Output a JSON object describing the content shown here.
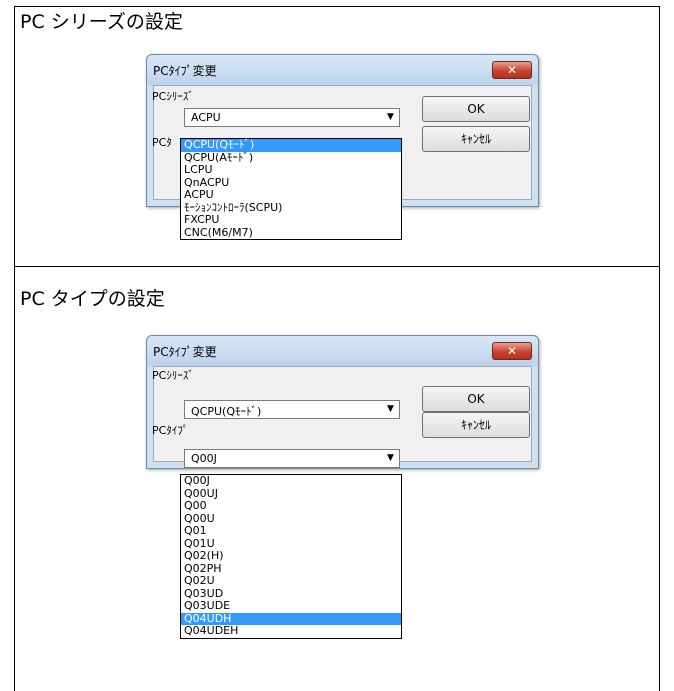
{
  "section1": {
    "heading": "PC シリーズの設定",
    "dialog": {
      "title": "PCﾀｲﾌﾟ変更",
      "close_symbol": "✕",
      "series_label": "PCｼﾘｰｽﾞ",
      "series_value": "ACPU",
      "type_label_partial": "PCﾀ",
      "ok_label": "OK",
      "cancel_label": "ｷｬﾝｾﾙ"
    },
    "series_options": [
      "QCPU(Qﾓｰﾄﾞ)",
      "QCPU(Aﾓｰﾄﾞ)",
      "LCPU",
      "QnACPU",
      "ACPU",
      "ﾓｰｼｮﾝｺﾝﾄﾛｰﾗ(SCPU)",
      "FXCPU",
      "CNC(M6/M7)"
    ],
    "selected_index": 0
  },
  "section2": {
    "heading": "PC タイプの設定",
    "dialog": {
      "title": "PCﾀｲﾌﾟ変更",
      "close_symbol": "✕",
      "series_label": "PCｼﾘｰｽﾞ",
      "series_value": "QCPU(Qﾓｰﾄﾞ)",
      "type_label": "PCﾀｲﾌﾟ",
      "type_value": "Q00J",
      "ok_label": "OK",
      "cancel_label": "ｷｬﾝｾﾙ"
    },
    "type_options": [
      "Q00J",
      "Q00UJ",
      "Q00",
      "Q00U",
      "Q01",
      "Q01U",
      "Q02(H)",
      "Q02PH",
      "Q02U",
      "Q03UD",
      "Q03UDE",
      "Q04UDH",
      "Q04UDEH"
    ],
    "selected_index": 11
  },
  "colors": {
    "selection": "#3399ff",
    "titlebar": "#bdd3ec",
    "close_button": "#c8442d"
  },
  "icons": {
    "combo_arrow": "chevron-down-icon",
    "close": "close-icon"
  }
}
